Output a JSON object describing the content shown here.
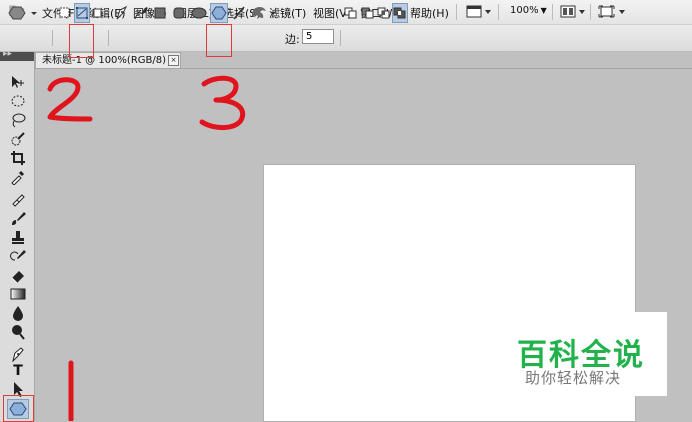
{
  "app": {
    "logo": "Ps"
  },
  "menu": {
    "items": [
      "文件(F)",
      "编辑(E)",
      "图像(I)",
      "图层(L)",
      "选择(S)",
      "滤镜(T)",
      "视图(V)",
      "窗口(W)",
      "帮助(H)"
    ],
    "zoom_value": "100%"
  },
  "options": {
    "sides_label": "边:",
    "sides_value": "5"
  },
  "document": {
    "tab_title": "未标题-1 @ 100%(RGB/8) *",
    "close_glyph": "×"
  },
  "tools": {
    "text_tool_glyph": "T"
  },
  "annotations": {
    "marker_color": "#e0141c",
    "labels": [
      "2",
      "3",
      "1"
    ]
  },
  "watermark": {
    "title": "百科全说",
    "subtitle": "助你轻松解决",
    "title_color": "#22b24c"
  },
  "colors": {
    "workspace": "#c0c0c0",
    "highlight": "#e23a3a",
    "selected_tool_bg": "#b7cbe3"
  }
}
